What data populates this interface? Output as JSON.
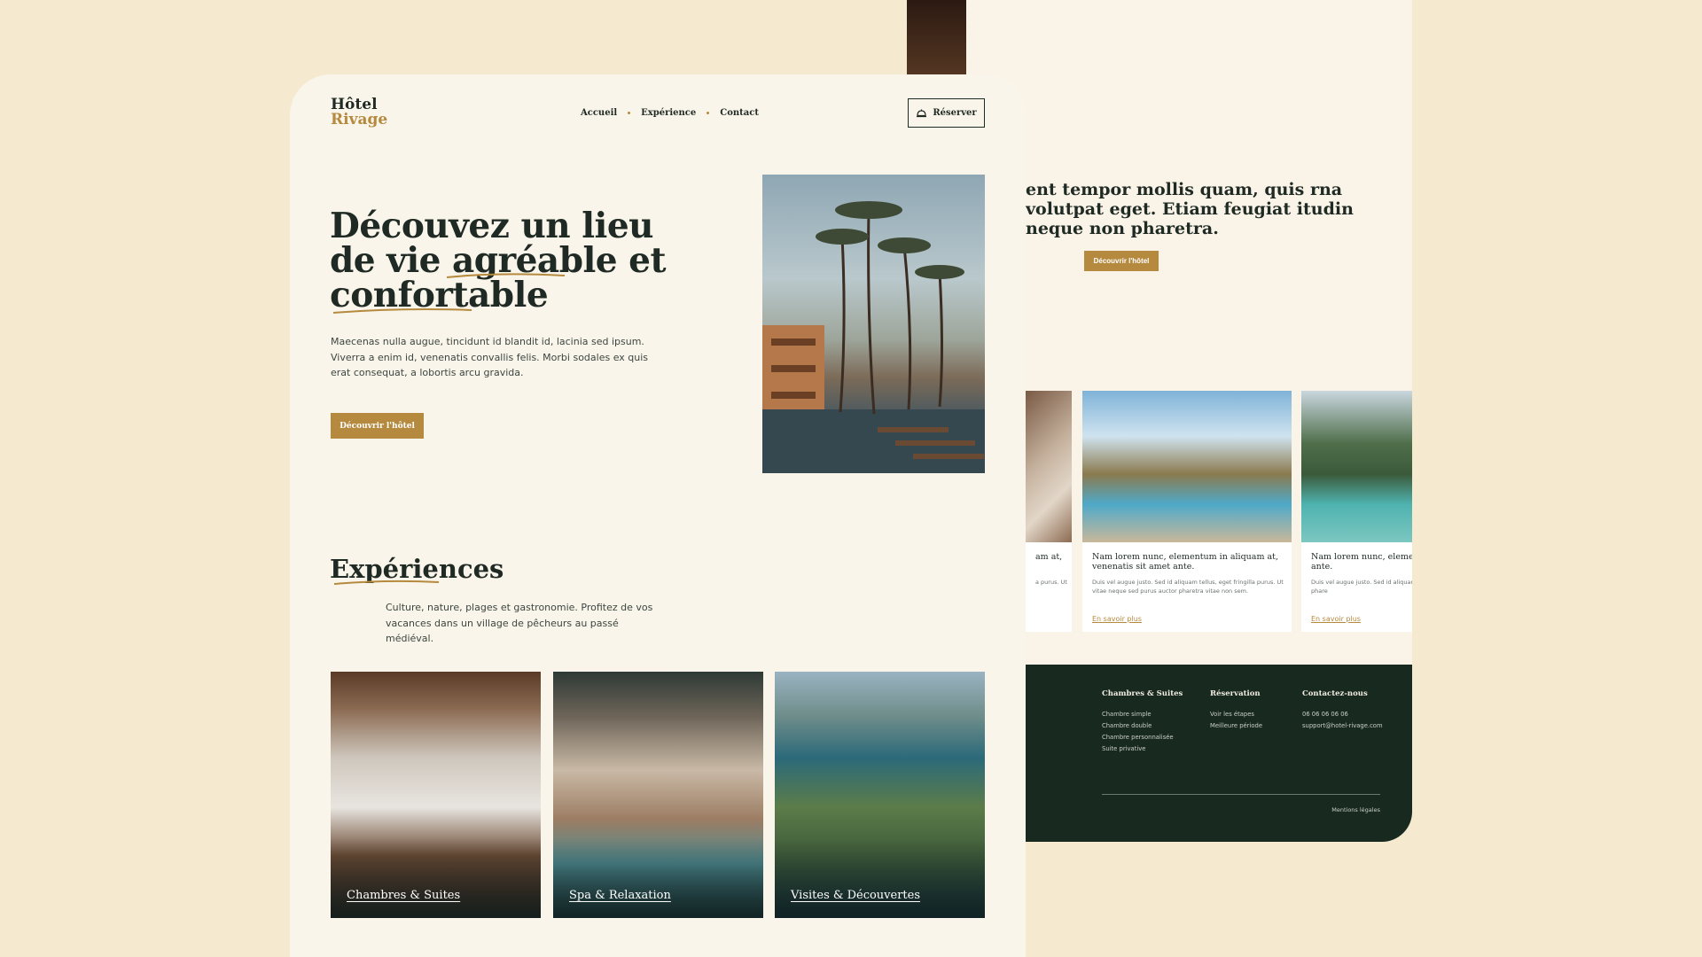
{
  "brand": {
    "line1": "Hôtel",
    "line2": "Rivage"
  },
  "nav": {
    "items": [
      "Accueil",
      "Expérience",
      "Contact"
    ]
  },
  "header": {
    "reserve_label": "Réserver"
  },
  "hero": {
    "title_lines": [
      "Découvez un lieu",
      "de vie agréable et",
      "confortable"
    ],
    "text": "Maecenas nulla augue, tincidunt id blandit id, lacinia sed ipsum. Viverra a enim id, venenatis convallis felis. Morbi sodales ex quis erat consequat, a lobortis arcu gravida.",
    "button_label": "Découvrir l'hôtel"
  },
  "experiences": {
    "title": "Expériences",
    "text": "Culture, nature, plages et gastronomie. Profitez de vos vacances dans un village de pêcheurs au passé médiéval.",
    "tiles": [
      "Chambres & Suites",
      "Spa & Relaxation",
      "Visites & Découvertes"
    ]
  },
  "right_panel": {
    "quote": "ent tempor mollis quam, quis rna volutpat eget. Etiam feugiat itudin neque non pharetra.",
    "button_label": "Découvrir l'hôtel",
    "cards": [
      {
        "title": "am at,",
        "body": "a purus. Ut",
        "more": ""
      },
      {
        "title": "Nam lorem nunc, elementum in aliquam at, venenatis sit amet ante.",
        "body": "Duis vel augue justo. Sed id aliquam tellus, eget fringilla purus. Ut vitae neque sed purus auctor pharetra vitae non sem.",
        "more": "En savoir plus"
      },
      {
        "title": "Nam lorem nunc, elemen venenatis sit amet ante.",
        "body": "Duis vel augue justo. Sed id aliquam vitae neque sed purus auctor phare",
        "more": "En savoir plus"
      }
    ]
  },
  "footer": {
    "columns": [
      {
        "heading": "Chambres & Suites",
        "items": [
          "Chambre simple",
          "Chambre double",
          "Chambre personnalisée",
          "Suite privative"
        ]
      },
      {
        "heading": "Réservation",
        "items": [
          "Voir les étapes",
          "Meilleure période"
        ]
      },
      {
        "heading": "Contactez-nous",
        "items": [
          "06 06 06 06 06",
          "support@hotel-rivage.com"
        ]
      }
    ],
    "legal": "Mentions légales"
  },
  "colors": {
    "accent": "#b58a3e",
    "dark": "#1f2a24",
    "footer_bg": "#18291f",
    "cream": "#faf5ea",
    "page_bg": "#f5e9cf"
  },
  "icons": {
    "reserve": "bell-icon"
  }
}
